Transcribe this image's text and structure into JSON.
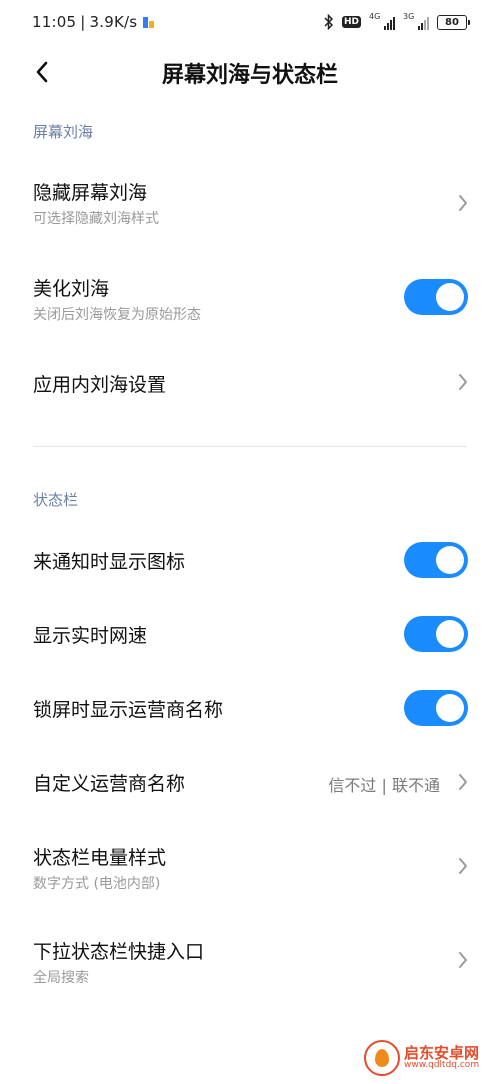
{
  "status_bar": {
    "time": "11:05",
    "separator": "|",
    "speed": "3.9K/s",
    "hd": "HD",
    "signal1_label": "4G",
    "signal2_label": "3G",
    "battery": "80"
  },
  "header": {
    "title": "屏幕刘海与状态栏"
  },
  "sections": {
    "notch_label": "屏幕刘海",
    "statusbar_label": "状态栏"
  },
  "rows": {
    "hide_notch": {
      "title": "隐藏屏幕刘海",
      "subtitle": "可选择隐藏刘海样式"
    },
    "beautify_notch": {
      "title": "美化刘海",
      "subtitle": "关闭后刘海恢复为原始形态",
      "enabled": true
    },
    "app_notch": {
      "title": "应用内刘海设置"
    },
    "notify_icons": {
      "title": "来通知时显示图标",
      "enabled": true
    },
    "net_speed": {
      "title": "显示实时网速",
      "enabled": true
    },
    "lock_carrier": {
      "title": "锁屏时显示运营商名称",
      "enabled": true
    },
    "custom_carrier": {
      "title": "自定义运营商名称",
      "value": "信不过 | 联不通"
    },
    "battery_style": {
      "title": "状态栏电量样式",
      "subtitle": "数字方式 (电池内部)"
    },
    "pulldown_shortcut": {
      "title": "下拉状态栏快捷入口",
      "subtitle": "全局搜索"
    }
  },
  "watermark": {
    "title": "启东安卓网",
    "url": "www.qdltdq.com"
  },
  "colors": {
    "accent": "#1a8cff",
    "section_label": "#6a7fa8",
    "subtitle": "#9a9a9a"
  }
}
